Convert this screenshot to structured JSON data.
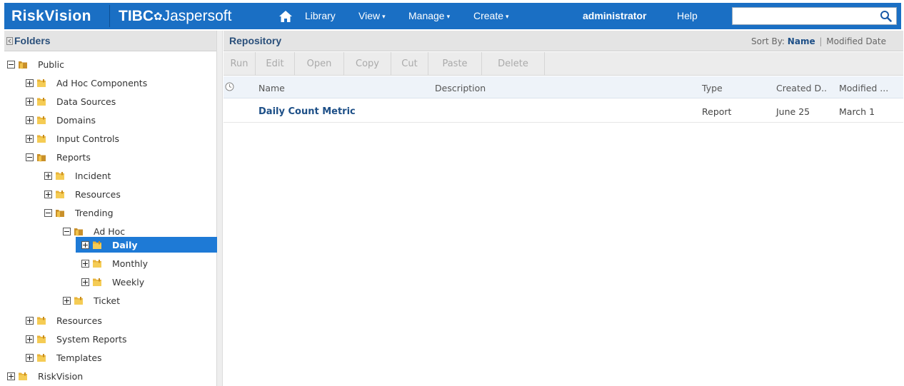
{
  "topbar": {
    "brand_risk": "RiskVision",
    "brand_tibco_bold": "TIBC",
    "brand_tibco_mark": "✿",
    "brand_tibco_rest": " Jaspersoft",
    "nav": {
      "library": "Library",
      "view": "View",
      "manage": "Manage",
      "create": "Create",
      "user": "administrator",
      "help": "Help"
    },
    "search_value": "",
    "accent_color": "#1a6fc4"
  },
  "folders": {
    "title": "Folders",
    "tree": [
      {
        "label": "Public",
        "toggle": "minus",
        "open": true
      },
      {
        "label": "Ad Hoc Components",
        "toggle": "plus",
        "open": false
      },
      {
        "label": "Data Sources",
        "toggle": "plus",
        "open": false
      },
      {
        "label": "Domains",
        "toggle": "plus",
        "open": false
      },
      {
        "label": "Input Controls",
        "toggle": "plus",
        "open": false
      },
      {
        "label": "Reports",
        "toggle": "minus",
        "open": true
      },
      {
        "label": "Incident",
        "toggle": "plus",
        "open": false
      },
      {
        "label": "Resources",
        "toggle": "plus",
        "open": false
      },
      {
        "label": "Trending",
        "toggle": "minus",
        "open": true
      },
      {
        "label": "Ad Hoc",
        "toggle": "minus",
        "open": true
      },
      {
        "label": "Daily",
        "toggle": "plus",
        "open": false,
        "selected": true
      },
      {
        "label": "Monthly",
        "toggle": "plus",
        "open": false
      },
      {
        "label": "Weekly",
        "toggle": "plus",
        "open": false
      },
      {
        "label": "Ticket",
        "toggle": "plus",
        "open": false
      },
      {
        "label": "Resources",
        "toggle": "plus",
        "open": false
      },
      {
        "label": "System Reports",
        "toggle": "plus",
        "open": false
      },
      {
        "label": "Templates",
        "toggle": "plus",
        "open": false
      },
      {
        "label": "RiskVision",
        "toggle": "plus",
        "open": false
      }
    ]
  },
  "repository": {
    "title": "Repository",
    "sort_label": "Sort By:",
    "sort_name": "Name",
    "sort_sep": "|",
    "sort_modified": "Modified Date",
    "toolbar": [
      "Run",
      "Edit",
      "Open",
      "Copy",
      "Cut",
      "Paste",
      "Delete"
    ],
    "columns": {
      "name": "Name",
      "description": "Description",
      "type": "Type",
      "created": "Created D..",
      "modified": "Modified ..."
    },
    "rows": [
      {
        "name": "Daily Count Metric",
        "description": "",
        "type": "Report",
        "created": "June 25",
        "modified": "March 1"
      }
    ]
  }
}
